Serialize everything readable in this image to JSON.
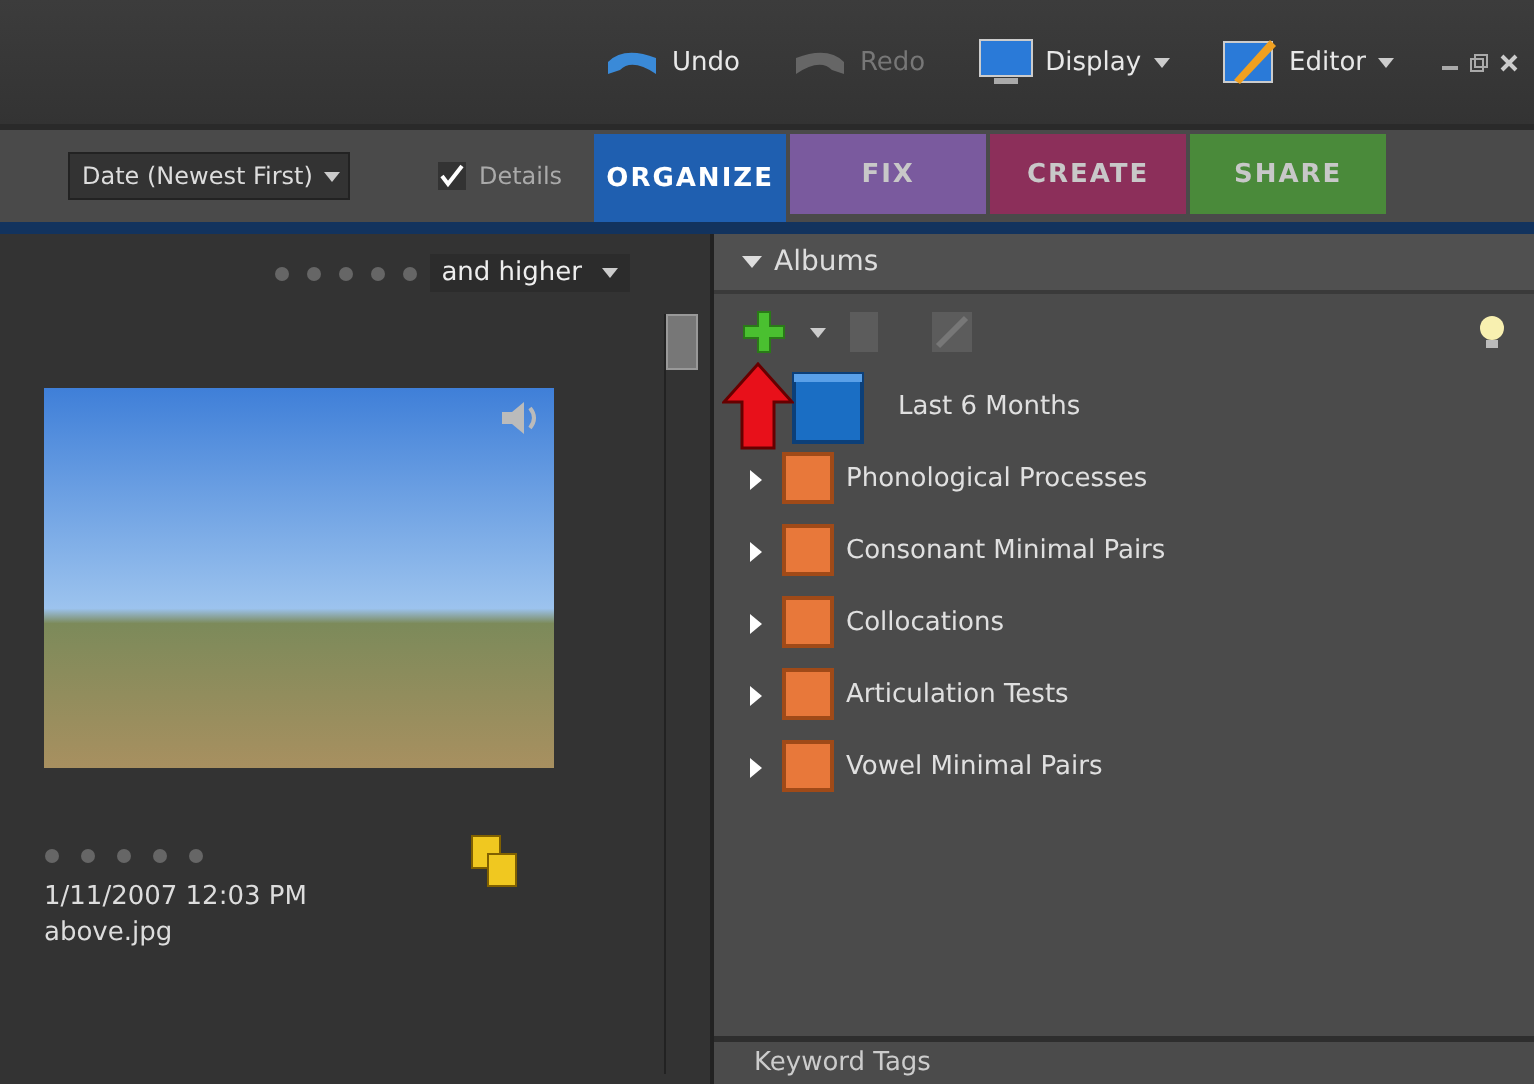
{
  "toolbar": {
    "undo": "Undo",
    "redo": "Redo",
    "display": "Display",
    "editor": "Editor"
  },
  "options": {
    "sort": "Date (Newest First)",
    "details": {
      "label": "Details",
      "checked": true
    }
  },
  "tabs": [
    {
      "label": "ORGANIZE",
      "selected": true,
      "color": "#1f5fb0"
    },
    {
      "label": "FIX",
      "selected": false,
      "color": "#7a5a9e"
    },
    {
      "label": "CREATE",
      "selected": false,
      "color": "#8c2f5a"
    },
    {
      "label": "SHARE",
      "selected": false,
      "color": "#4a8a3a"
    }
  ],
  "browser": {
    "filter": {
      "stars": 0,
      "rating": "and higher"
    },
    "photo": {
      "stars": 0,
      "date": "1/11/2007 12:03 PM",
      "filename": "above.jpg"
    }
  },
  "albums": {
    "title": "Albums",
    "expanded": true,
    "items": [
      {
        "kind": "smart",
        "name": "Last 6 Months"
      },
      {
        "kind": "album",
        "name": "Phonological Processes",
        "expanded": false
      },
      {
        "kind": "album",
        "name": "Consonant Minimal Pairs",
        "expanded": false
      },
      {
        "kind": "album",
        "name": "Collocations",
        "expanded": false
      },
      {
        "kind": "album",
        "name": "Articulation Tests",
        "expanded": false
      },
      {
        "kind": "album",
        "name": "Vowel Minimal Pairs",
        "expanded": false
      }
    ]
  },
  "keyword_tags": {
    "title": "Keyword Tags"
  }
}
